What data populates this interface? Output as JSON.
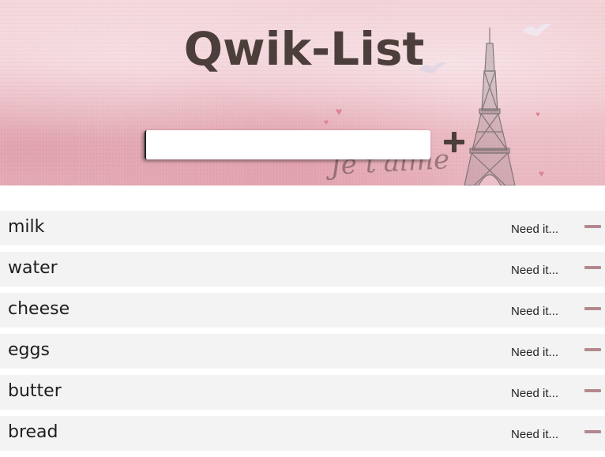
{
  "header": {
    "title": "Qwik-List",
    "decoration_text": "Je t'aime",
    "background_color": "#efc6cd",
    "title_color": "#4b3e3b"
  },
  "add_form": {
    "input_value": "",
    "add_icon": "plus-icon"
  },
  "items": [
    {
      "name": "milk",
      "status": "Need it..."
    },
    {
      "name": "water",
      "status": "Need it..."
    },
    {
      "name": "cheese",
      "status": "Need it..."
    },
    {
      "name": "eggs",
      "status": "Need it..."
    },
    {
      "name": "butter",
      "status": "Need it..."
    },
    {
      "name": "bread",
      "status": "Need it..."
    }
  ],
  "remove_icon": "minus-icon",
  "accent_color": "#b2898e",
  "item_background": "#f3f3f3"
}
